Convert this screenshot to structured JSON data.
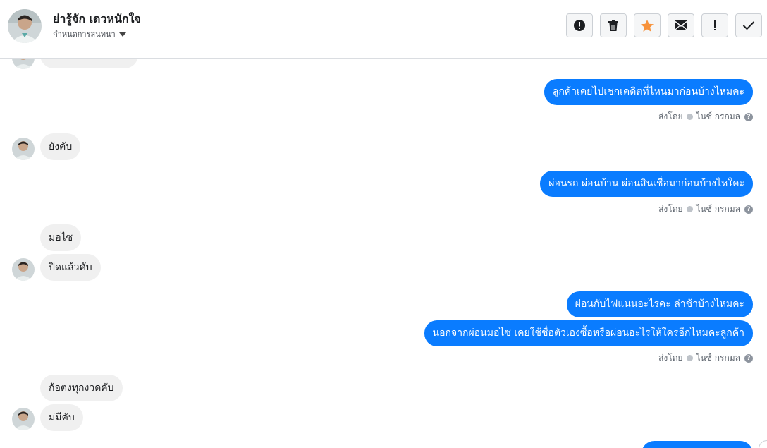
{
  "header": {
    "name": "ย่ารู้จัก เดวหนักใจ",
    "subtitle": "กำหนดการสนทนา",
    "actions": [
      {
        "icon": "alert-circle-icon"
      },
      {
        "icon": "trash-icon"
      },
      {
        "icon": "star-icon",
        "color": "#f7923b"
      },
      {
        "icon": "envelope-icon"
      },
      {
        "icon": "exclamation-icon"
      },
      {
        "icon": "checkmark-icon"
      }
    ]
  },
  "colors": {
    "outgoing_bubble": "#0a7cff",
    "incoming_bubble": "#f0f0f0",
    "star": "#f7923b"
  },
  "messages": {
    "out_1": "ลูกค้าเคยไปเชกเคดิตที่ไหนมาก่อนบ้างไหมคะ",
    "sent_1": {
      "prefix": "ส่งโดย",
      "name": "ไนซ์ กรกมล",
      "help": "?"
    },
    "in_1": "ยังคับ",
    "out_2": "ผ่อนรถ ผ่อนบ้าน ผ่อนสินเชื่อมาก่อนบ้างไหใคะ",
    "sent_2": {
      "prefix": "ส่งโดย",
      "name": "ไนซ์ กรกมล",
      "help": "?"
    },
    "in_2": "มอไซ",
    "in_3": "ปิดแล้วคับ",
    "out_3": "ผ่อนกับไฟแนนอะไรคะ ล่าช้าบ้างไหมคะ",
    "out_4": "นอกจากผ่อนมอไซ เคยใช้ชื่อตัวเองซื้อหรือผ่อนอะไรให้ใครอีกไหมคะลูกค้า",
    "sent_3": {
      "prefix": "ส่งโดย",
      "name": "ไนซ์ กรกมล",
      "help": "?"
    },
    "in_4": "ก้อตงทุกงวดคับ",
    "in_5": "ม่มีคับ"
  }
}
